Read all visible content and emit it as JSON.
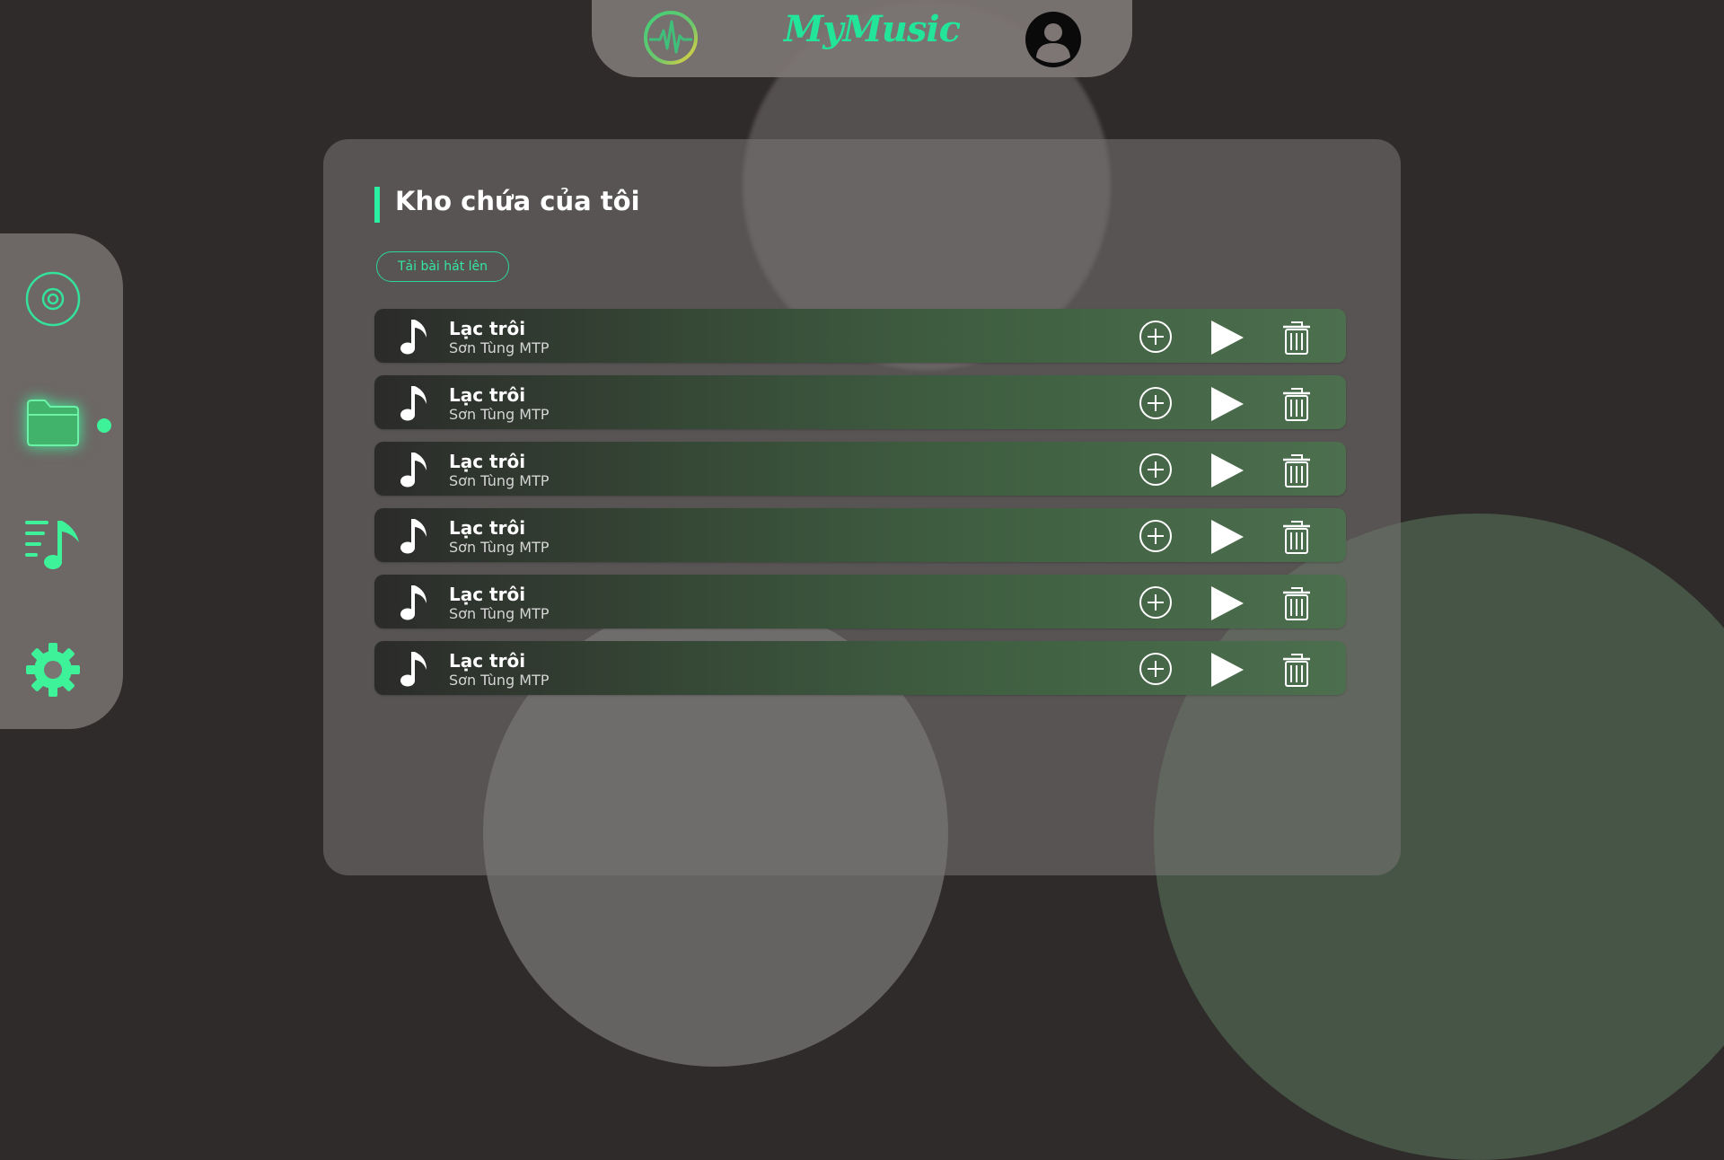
{
  "colors": {
    "accent": "#22e59a",
    "background": "#2f2b2a"
  },
  "header": {
    "brand": "MyMusic",
    "logo_icon": "pulse-logo-icon",
    "account_icon": "user-avatar-icon"
  },
  "sidebar": {
    "items": [
      {
        "name": "disc",
        "icon": "disc-icon"
      },
      {
        "name": "library",
        "icon": "folder-icon",
        "active": true
      },
      {
        "name": "playlist",
        "icon": "playlist-icon"
      },
      {
        "name": "settings",
        "icon": "gear-icon"
      }
    ]
  },
  "main": {
    "title": "Kho chứa của tôi",
    "upload_label": "Tải bài hát lên",
    "songs": [
      {
        "title": "Lạc trôi",
        "artist": "Sơn Tùng MTP"
      },
      {
        "title": "Lạc trôi",
        "artist": "Sơn Tùng MTP"
      },
      {
        "title": "Lạc trôi",
        "artist": "Sơn Tùng MTP"
      },
      {
        "title": "Lạc trôi",
        "artist": "Sơn Tùng MTP"
      },
      {
        "title": "Lạc trôi",
        "artist": "Sơn Tùng MTP"
      },
      {
        "title": "Lạc trôi",
        "artist": "Sơn Tùng MTP"
      }
    ]
  }
}
